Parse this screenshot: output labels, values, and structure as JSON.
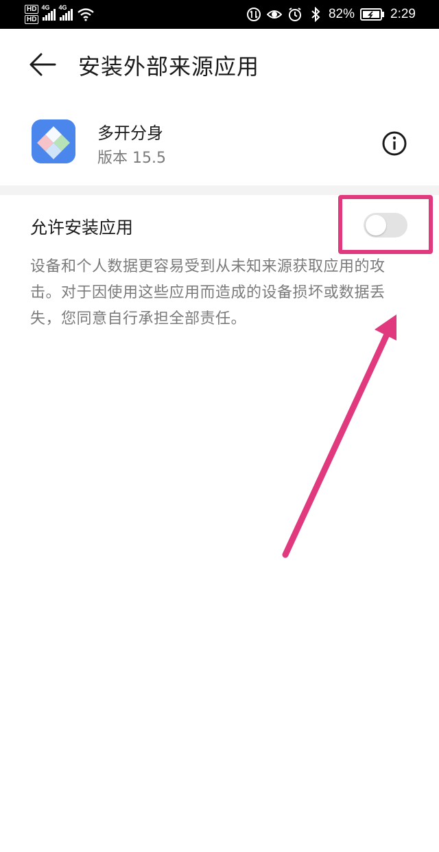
{
  "status_bar": {
    "hd1": "HD",
    "hd2": "HD",
    "net1": "4G",
    "net2": "4G",
    "battery_percent": "82%",
    "time": "2:29"
  },
  "header": {
    "title": "安装外部来源应用"
  },
  "app": {
    "name": "多开分身",
    "version": "版本 15.5"
  },
  "setting": {
    "label": "允许安装应用",
    "enabled": false
  },
  "description": "设备和个人数据更容易受到从未知来源获取应用的攻击。对于因使用这些应用而造成的设备损坏或数据丢失，您同意自行承担全部责任。",
  "colors": {
    "annotation": "#e0397e",
    "toggle_off_track": "#e3e3e3",
    "app_icon": "#3c7ae8"
  },
  "icons": {
    "back": "back-arrow-icon",
    "info": "info-icon",
    "wifi": "wifi-icon",
    "battery": "battery-icon"
  }
}
